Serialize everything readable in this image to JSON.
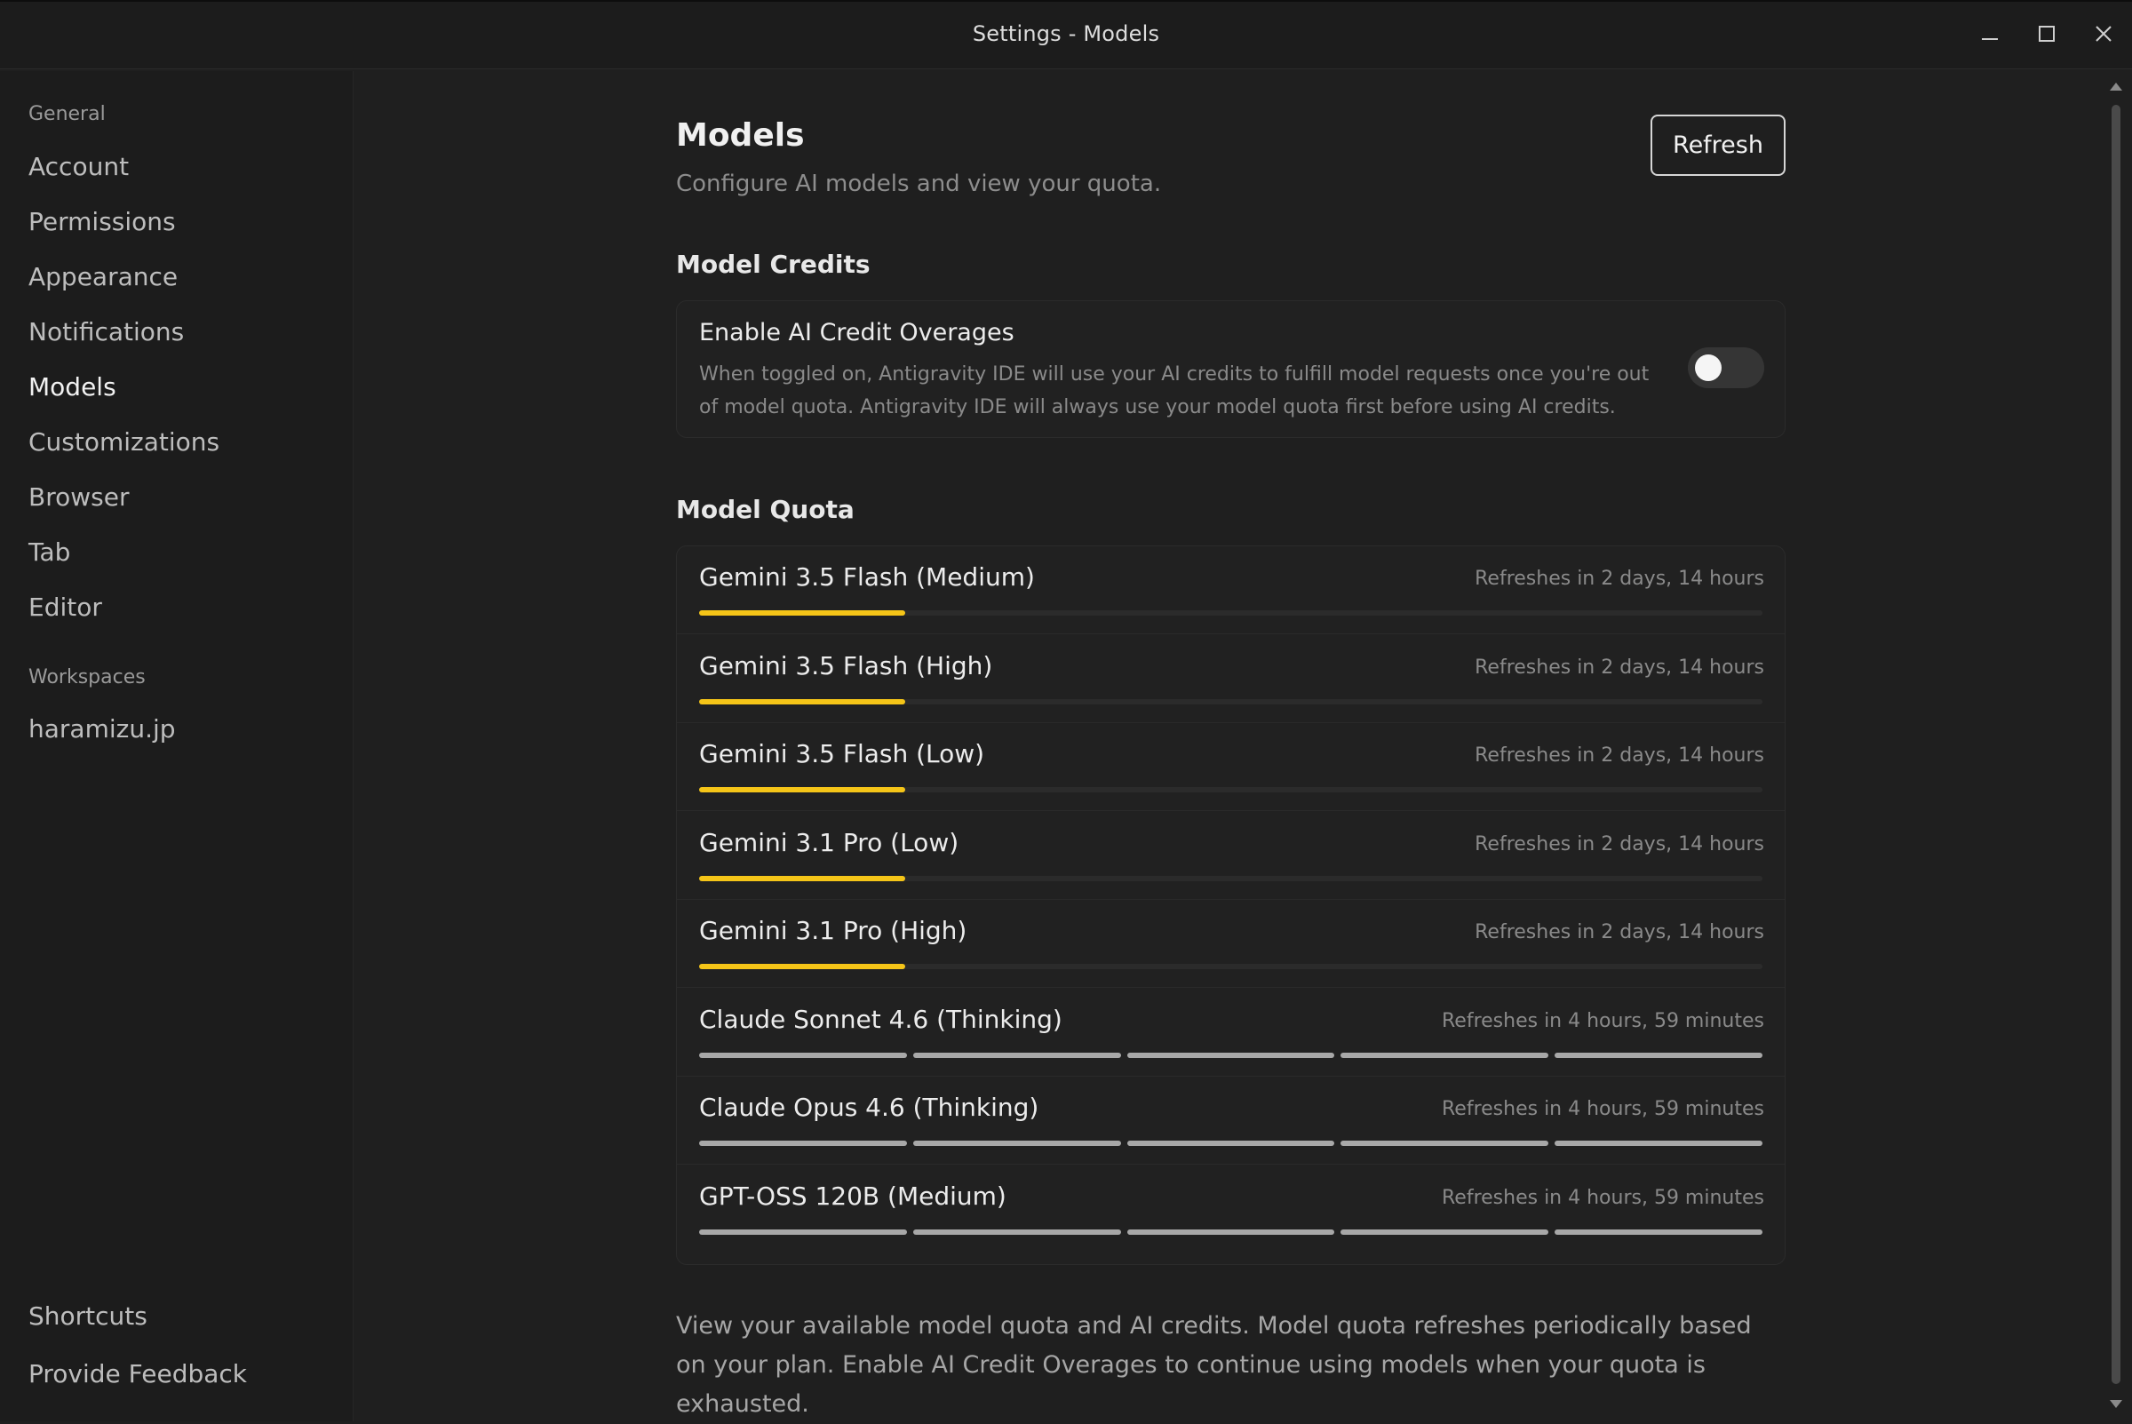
{
  "window": {
    "title": "Settings - Models"
  },
  "sidebar": {
    "section_general": "General",
    "items": [
      {
        "label": "Account"
      },
      {
        "label": "Permissions"
      },
      {
        "label": "Appearance"
      },
      {
        "label": "Notifications"
      },
      {
        "label": "Models",
        "active": true
      },
      {
        "label": "Customizations"
      },
      {
        "label": "Browser"
      },
      {
        "label": "Tab"
      },
      {
        "label": "Editor"
      }
    ],
    "section_workspaces": "Workspaces",
    "workspaces": [
      {
        "label": "haramizu.jp"
      }
    ],
    "bottom": [
      {
        "label": "Shortcuts"
      },
      {
        "label": "Provide Feedback"
      }
    ]
  },
  "main": {
    "title": "Models",
    "subtitle": "Configure AI models and view your quota.",
    "refresh_label": "Refresh",
    "credits_section": "Model Credits",
    "credits": {
      "title": "Enable AI Credit Overages",
      "description": "When toggled on, Antigravity IDE will use your AI credits to fulfill model requests once you're out of model quota. Antigravity IDE will always use your model quota first before using AI credits.",
      "enabled": false
    },
    "quota_section": "Model Quota",
    "quota": [
      {
        "name": "Gemini 3.5 Flash (Medium)",
        "refresh": "Refreshes in 2 days, 14 hours",
        "fraction": 0.2,
        "segmented": false
      },
      {
        "name": "Gemini 3.5 Flash (High)",
        "refresh": "Refreshes in 2 days, 14 hours",
        "fraction": 0.2,
        "segmented": false
      },
      {
        "name": "Gemini 3.5 Flash (Low)",
        "refresh": "Refreshes in 2 days, 14 hours",
        "fraction": 0.2,
        "segmented": false
      },
      {
        "name": "Gemini 3.1 Pro (Low)",
        "refresh": "Refreshes in 2 days, 14 hours",
        "fraction": 0.2,
        "segmented": false
      },
      {
        "name": "Gemini 3.1 Pro (High)",
        "refresh": "Refreshes in 2 days, 14 hours",
        "fraction": 0.2,
        "segmented": false
      },
      {
        "name": "Claude Sonnet 4.6 (Thinking)",
        "refresh": "Refreshes in 4 hours, 59 minutes",
        "fraction": 1.0,
        "segmented": true
      },
      {
        "name": "Claude Opus 4.6 (Thinking)",
        "refresh": "Refreshes in 4 hours, 59 minutes",
        "fraction": 1.0,
        "segmented": true
      },
      {
        "name": "GPT-OSS 120B (Medium)",
        "refresh": "Refreshes in 4 hours, 59 minutes",
        "fraction": 1.0,
        "segmented": true
      }
    ],
    "footer": "View your available model quota and AI credits. Model quota refreshes periodically based on your plan. Enable AI Credit Overages to continue using models when your quota is exhausted."
  },
  "colors": {
    "accent": "#f5c518",
    "segment": "#a8a8a8",
    "track": "#2b2b2b"
  },
  "icons": {
    "minimize": "minimize-icon",
    "maximize": "maximize-icon",
    "close": "close-icon"
  }
}
